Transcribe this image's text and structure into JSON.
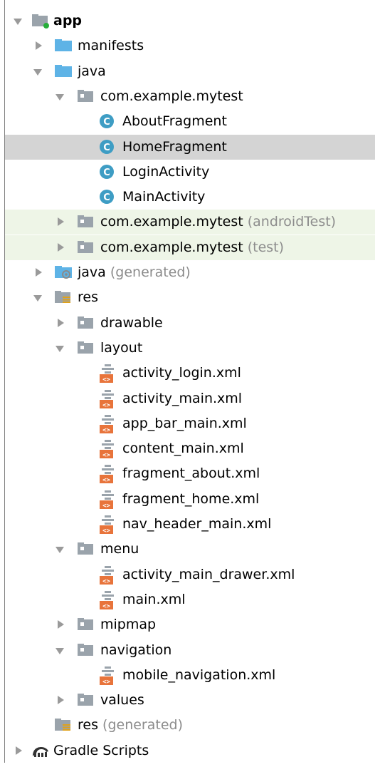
{
  "tree": [
    {
      "id": "app",
      "label": "app",
      "depth": 0,
      "arrow": "down",
      "icon": "module-folder-icon",
      "bold": true
    },
    {
      "id": "manifests",
      "label": "manifests",
      "depth": 1,
      "arrow": "right",
      "icon": "folder-icon"
    },
    {
      "id": "java",
      "label": "java",
      "depth": 1,
      "arrow": "down",
      "icon": "folder-icon"
    },
    {
      "id": "pkg-main",
      "label": "com.example.mytest",
      "depth": 2,
      "arrow": "down",
      "icon": "package-icon"
    },
    {
      "id": "about-fragment",
      "label": "AboutFragment",
      "depth": 3,
      "icon": "class-icon"
    },
    {
      "id": "home-fragment",
      "label": "HomeFragment",
      "depth": 3,
      "icon": "class-icon",
      "selected": true
    },
    {
      "id": "login-activity",
      "label": "LoginActivity",
      "depth": 3,
      "icon": "class-icon"
    },
    {
      "id": "main-activity",
      "label": "MainActivity",
      "depth": 3,
      "icon": "class-icon"
    },
    {
      "id": "pkg-androidtest",
      "label": "com.example.mytest",
      "suffix": "(androidTest)",
      "depth": 2,
      "arrow": "right",
      "icon": "package-icon",
      "test": true
    },
    {
      "id": "pkg-test",
      "label": "com.example.mytest",
      "suffix": "(test)",
      "depth": 2,
      "arrow": "right",
      "icon": "package-icon",
      "test": true
    },
    {
      "id": "java-generated",
      "label": "java",
      "suffix": "(generated)",
      "depth": 1,
      "arrow": "right",
      "icon": "generated-folder-icon"
    },
    {
      "id": "res",
      "label": "res",
      "depth": 1,
      "arrow": "down",
      "icon": "resource-folder-icon"
    },
    {
      "id": "drawable",
      "label": "drawable",
      "depth": 2,
      "arrow": "right",
      "icon": "package-icon"
    },
    {
      "id": "layout",
      "label": "layout",
      "depth": 2,
      "arrow": "down",
      "icon": "package-icon"
    },
    {
      "id": "activity-login-xml",
      "label": "activity_login.xml",
      "depth": 3,
      "icon": "layout-xml-icon"
    },
    {
      "id": "activity-main-xml",
      "label": "activity_main.xml",
      "depth": 3,
      "icon": "layout-xml-icon"
    },
    {
      "id": "app-bar-main-xml",
      "label": "app_bar_main.xml",
      "depth": 3,
      "icon": "layout-xml-icon"
    },
    {
      "id": "content-main-xml",
      "label": "content_main.xml",
      "depth": 3,
      "icon": "layout-xml-icon"
    },
    {
      "id": "fragment-about-xml",
      "label": "fragment_about.xml",
      "depth": 3,
      "icon": "layout-xml-icon"
    },
    {
      "id": "fragment-home-xml",
      "label": "fragment_home.xml",
      "depth": 3,
      "icon": "layout-xml-icon"
    },
    {
      "id": "nav-header-main-xml",
      "label": "nav_header_main.xml",
      "depth": 3,
      "icon": "layout-xml-icon"
    },
    {
      "id": "menu",
      "label": "menu",
      "depth": 2,
      "arrow": "down",
      "icon": "package-icon"
    },
    {
      "id": "activity-main-drawer-xml",
      "label": "activity_main_drawer.xml",
      "depth": 3,
      "icon": "layout-xml-icon"
    },
    {
      "id": "main-xml",
      "label": "main.xml",
      "depth": 3,
      "icon": "layout-xml-icon"
    },
    {
      "id": "mipmap",
      "label": "mipmap",
      "depth": 2,
      "arrow": "right",
      "icon": "package-icon"
    },
    {
      "id": "navigation",
      "label": "navigation",
      "depth": 2,
      "arrow": "down",
      "icon": "package-icon"
    },
    {
      "id": "mobile-navigation-xml",
      "label": "mobile_navigation.xml",
      "depth": 3,
      "icon": "layout-xml-icon"
    },
    {
      "id": "values",
      "label": "values",
      "depth": 2,
      "arrow": "right",
      "icon": "package-icon"
    },
    {
      "id": "res-generated",
      "label": "res",
      "suffix": "(generated)",
      "depth": 1,
      "icon": "resource-folder-icon"
    },
    {
      "id": "gradle-scripts",
      "label": "Gradle Scripts",
      "depth": 0,
      "arrow": "right",
      "icon": "gradle-icon"
    }
  ],
  "colors": {
    "selected_row": "#d4d4d4",
    "test_row": "#eef5e7",
    "folder_blue": "#5eb3e6",
    "package_gray": "#9aa3ab",
    "class_teal": "#3e9dc4",
    "xml_orange": "#e8743b",
    "suffix_gray": "#8c8c8c"
  }
}
